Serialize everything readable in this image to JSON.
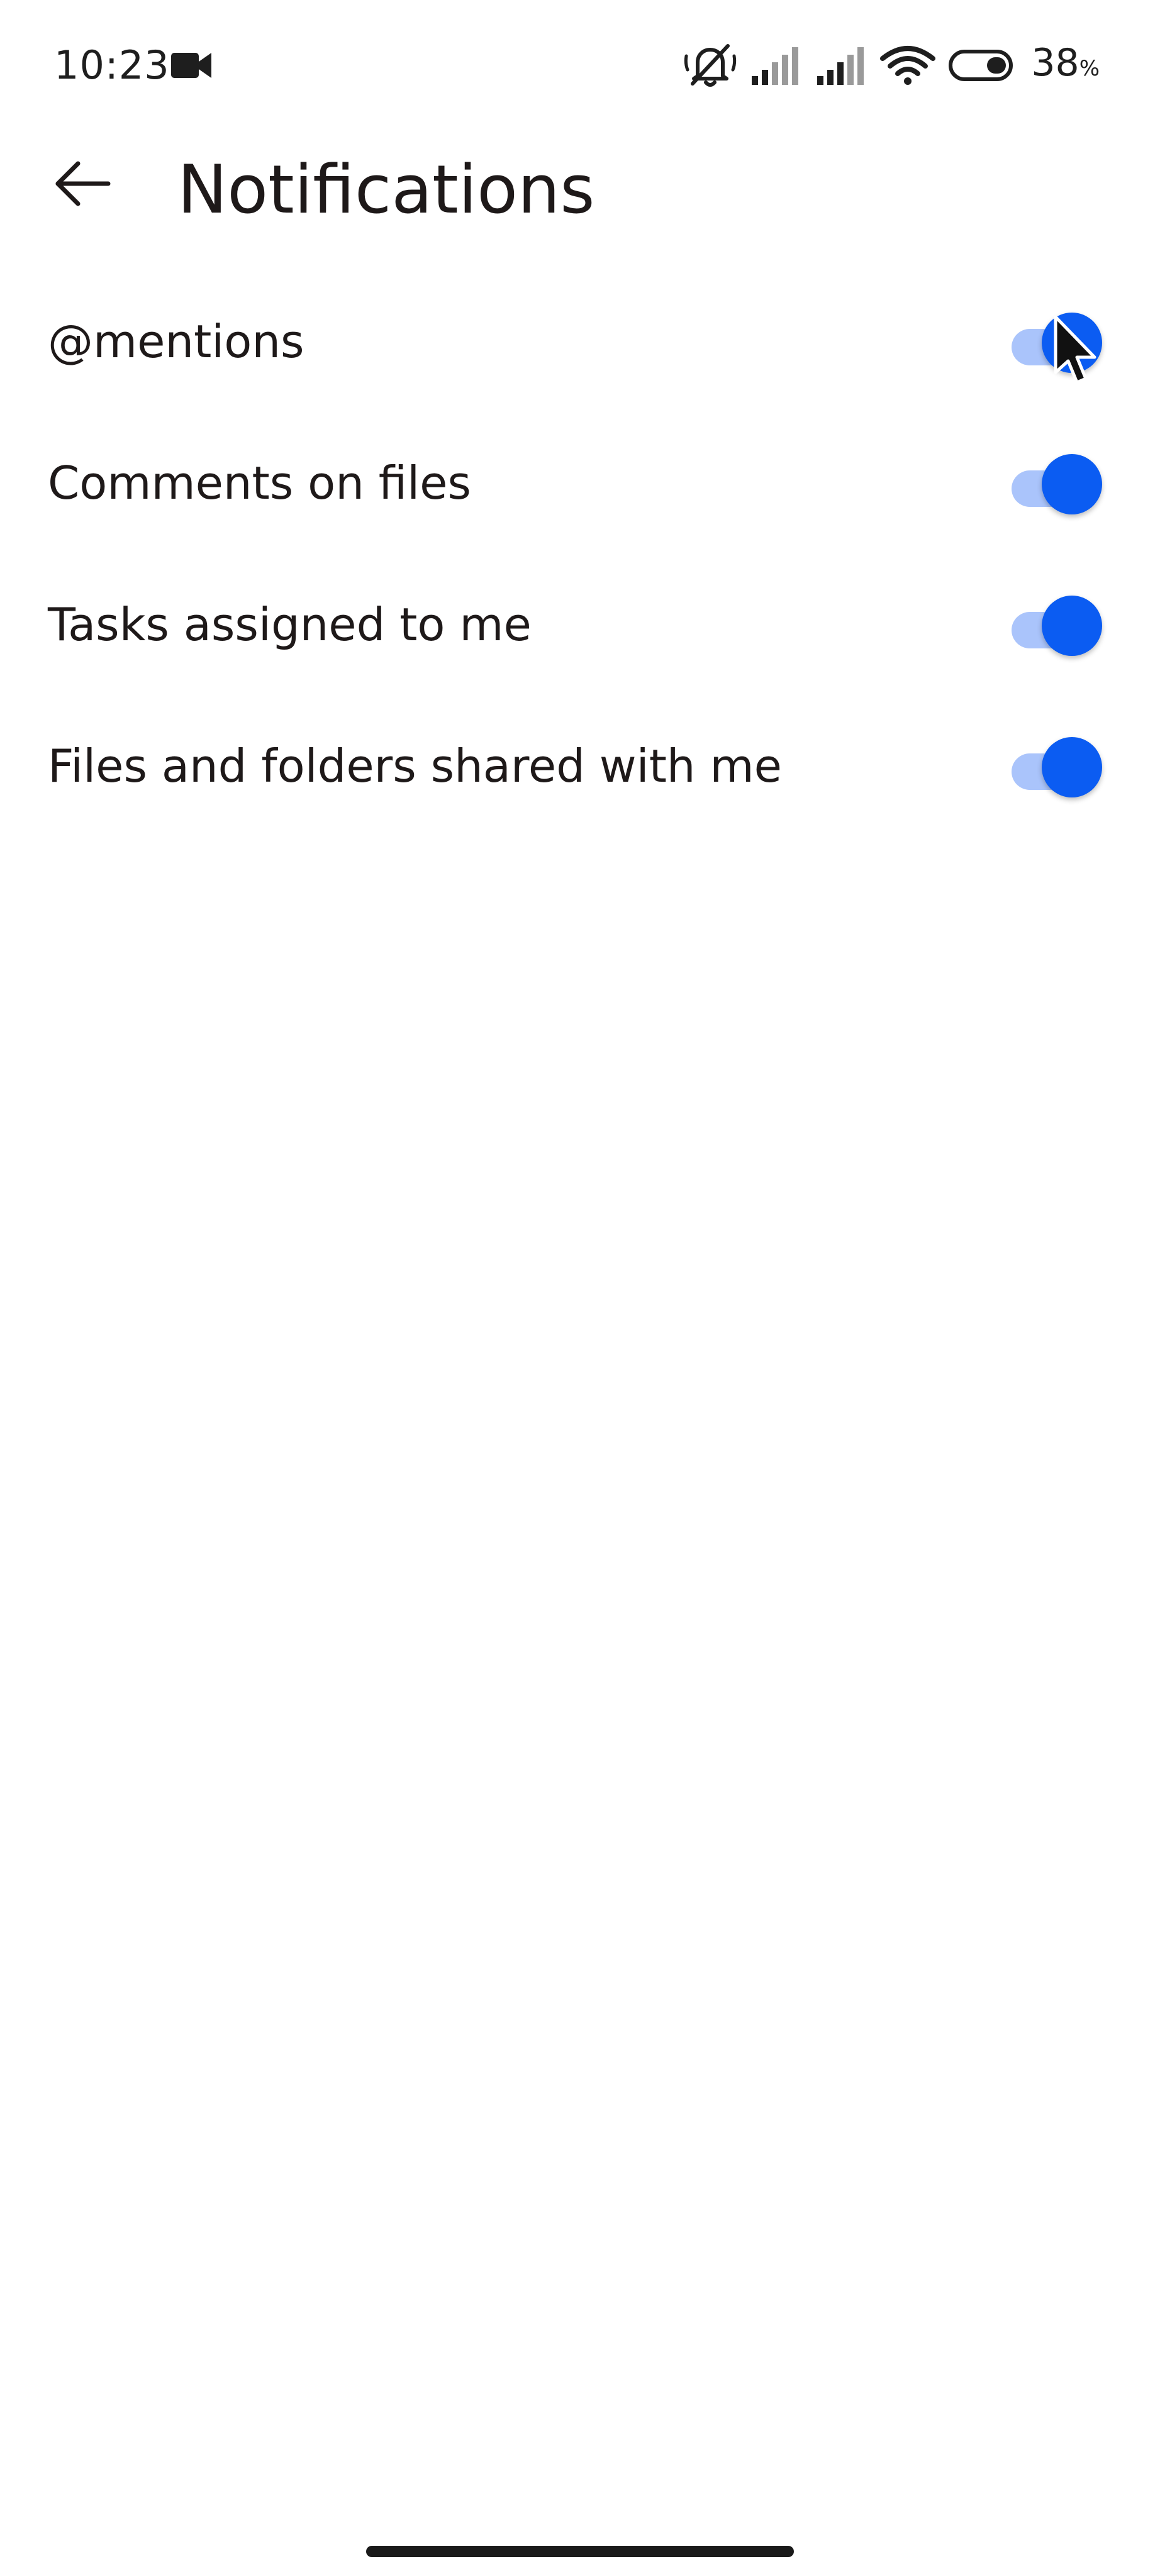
{
  "status_bar": {
    "time": "10:23",
    "left_icons": [
      "video-camera-icon"
    ],
    "right_icons": [
      "muted-bell-icon",
      "cell-signal-icon",
      "cell-signal-icon",
      "wifi-icon",
      "battery-icon"
    ],
    "battery_percent": "38",
    "battery_unit": "%"
  },
  "app_bar": {
    "back_icon": "arrow-left-icon",
    "title": "Notifications"
  },
  "settings": [
    {
      "label": "@mentions",
      "enabled": true
    },
    {
      "label": "Comments on files",
      "enabled": true
    },
    {
      "label": "Tasks assigned to me",
      "enabled": true
    },
    {
      "label": "Files and folders shared with me",
      "enabled": true
    }
  ],
  "colors": {
    "accent": "#0b5cf2",
    "accent_track": "#aac4fb",
    "text": "#1e1919",
    "background": "#ffffff"
  }
}
